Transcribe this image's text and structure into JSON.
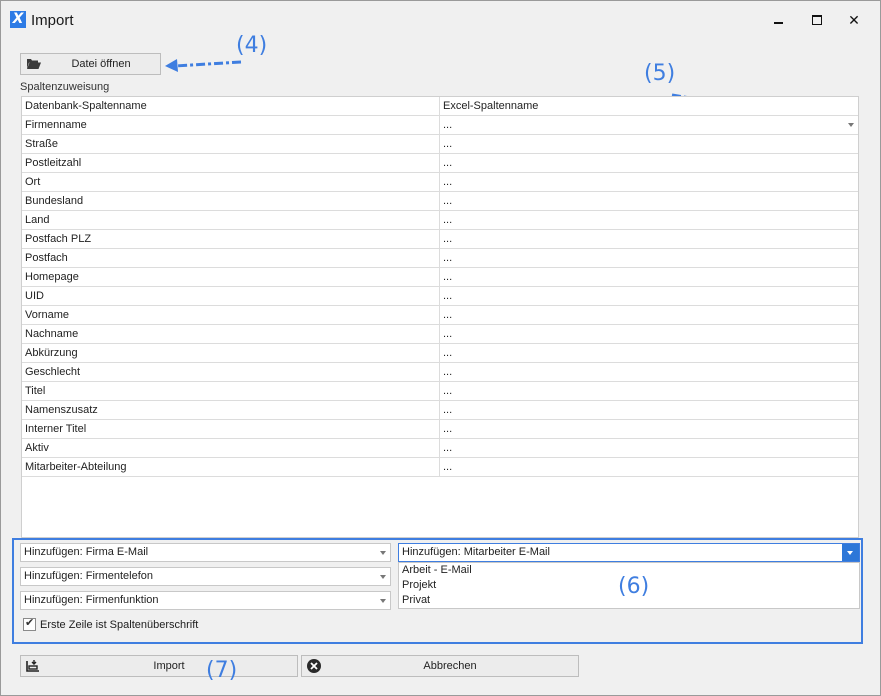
{
  "window": {
    "title": "Import",
    "app_icon": "X"
  },
  "toolbar": {
    "open_file_label": "Datei öffnen",
    "open_file_icon": "folder-open-icon"
  },
  "annotations": {
    "a4": "(4)",
    "a5": "(5)",
    "a6": "(6)",
    "a7": "(7)"
  },
  "mapping": {
    "section_label": "Spaltenzuweisung",
    "col_db": "Datenbank-Spaltenname",
    "col_excel": "Excel-Spaltenname",
    "rows": [
      {
        "db": "Firmenname",
        "excel": "..."
      },
      {
        "db": "Straße",
        "excel": "..."
      },
      {
        "db": "Postleitzahl",
        "excel": "..."
      },
      {
        "db": "Ort",
        "excel": "..."
      },
      {
        "db": "Bundesland",
        "excel": "..."
      },
      {
        "db": "Land",
        "excel": "..."
      },
      {
        "db": "Postfach PLZ",
        "excel": "..."
      },
      {
        "db": "Postfach",
        "excel": "..."
      },
      {
        "db": "Homepage",
        "excel": "..."
      },
      {
        "db": "UID",
        "excel": "..."
      },
      {
        "db": "Vorname",
        "excel": "..."
      },
      {
        "db": "Nachname",
        "excel": "..."
      },
      {
        "db": "Abkürzung",
        "excel": "..."
      },
      {
        "db": "Geschlecht",
        "excel": "..."
      },
      {
        "db": "Titel",
        "excel": "..."
      },
      {
        "db": "Namenszusatz",
        "excel": "..."
      },
      {
        "db": "Interner Titel",
        "excel": "..."
      },
      {
        "db": "Aktiv",
        "excel": "..."
      },
      {
        "db": "Mitarbeiter-Abteilung",
        "excel": "..."
      }
    ]
  },
  "options": {
    "firma_email": "Hinzufügen: Firma E-Mail",
    "firmentelefon": "Hinzufügen: Firmentelefon",
    "firmenfunktion": "Hinzufügen: Firmenfunktion",
    "mitarbeiter_email": "Hinzufügen: Mitarbeiter E-Mail",
    "dropdown_items": [
      "Arbeit - E-Mail",
      "Projekt",
      "Privat"
    ],
    "first_row_header_label": "Erste Zeile ist Spaltenüberschrift",
    "first_row_header_checked": true
  },
  "actions": {
    "import_label": "Import",
    "cancel_label": "Abbrechen"
  },
  "colors": {
    "accent": "#3f7ee0",
    "dropdown_button": "#2d77d8"
  }
}
